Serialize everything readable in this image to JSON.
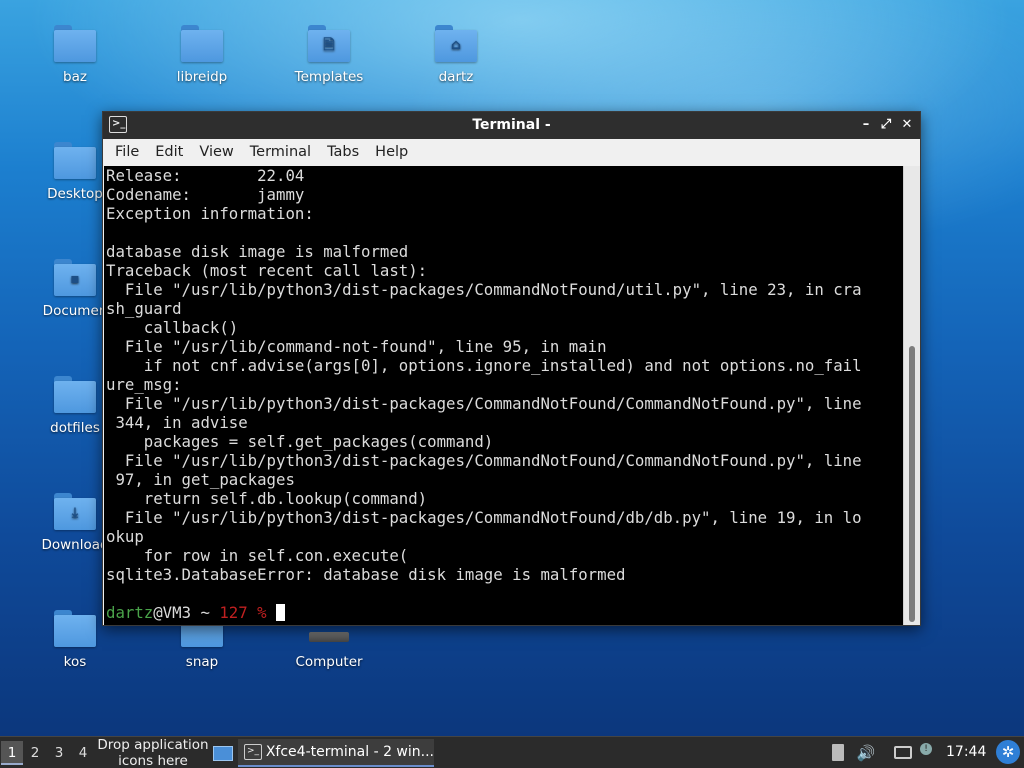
{
  "desktop": {
    "icons": [
      {
        "label": "baz",
        "glyph": ""
      },
      {
        "label": "libreidp",
        "glyph": ""
      },
      {
        "label": "Templates",
        "glyph": "🗎"
      },
      {
        "label": "dartz",
        "glyph": "⌂"
      },
      {
        "label": "Desktop",
        "glyph": ""
      },
      {
        "label": "Documen",
        "glyph": "▪"
      },
      {
        "label": "dotfiles",
        "glyph": ""
      },
      {
        "label": "Download",
        "glyph": "⤓"
      },
      {
        "label": "kos",
        "glyph": ""
      },
      {
        "label": "snap",
        "glyph": ""
      },
      {
        "label": "Computer",
        "glyph": ""
      }
    ]
  },
  "window": {
    "title": "Terminal -",
    "app_icon": ">_",
    "controls": {
      "minimize": "–",
      "maximize": "⤢",
      "close": "✕"
    },
    "menu": [
      "File",
      "Edit",
      "View",
      "Terminal",
      "Tabs",
      "Help"
    ]
  },
  "terminal": {
    "lines": [
      "Release:        22.04",
      "Codename:       jammy",
      "Exception information:",
      "",
      "database disk image is malformed",
      "Traceback (most recent call last):",
      "  File \"/usr/lib/python3/dist-packages/CommandNotFound/util.py\", line 23, in cra",
      "sh_guard",
      "    callback()",
      "  File \"/usr/lib/command-not-found\", line 95, in main",
      "    if not cnf.advise(args[0], options.ignore_installed) and not options.no_fail",
      "ure_msg:",
      "  File \"/usr/lib/python3/dist-packages/CommandNotFound/CommandNotFound.py\", line",
      " 344, in advise",
      "    packages = self.get_packages(command)",
      "  File \"/usr/lib/python3/dist-packages/CommandNotFound/CommandNotFound.py\", line",
      " 97, in get_packages",
      "    return self.db.lookup(command)",
      "  File \"/usr/lib/python3/dist-packages/CommandNotFound/db/db.py\", line 19, in lo",
      "okup",
      "    for row in self.con.execute(",
      "sqlite3.DatabaseError: database disk image is malformed",
      ""
    ],
    "prompt": {
      "user": "dartz",
      "host": "@VM3 ~ ",
      "code": "127 % "
    },
    "scroll_position": 1.0
  },
  "taskbar": {
    "workspaces": [
      "1",
      "2",
      "3",
      "4"
    ],
    "active_workspace": "1",
    "drop_text_1": "Drop application",
    "drop_text_2": "icons here",
    "task_label": "Xfce4-terminal - 2 win...",
    "task_icon": ">_",
    "clock": "17:44"
  },
  "colors": {
    "prompt_user": "#4aa34a",
    "prompt_exit_code": "#c02020",
    "terminal_bg": "#000000",
    "titlebar_bg": "#2e2e2e"
  }
}
